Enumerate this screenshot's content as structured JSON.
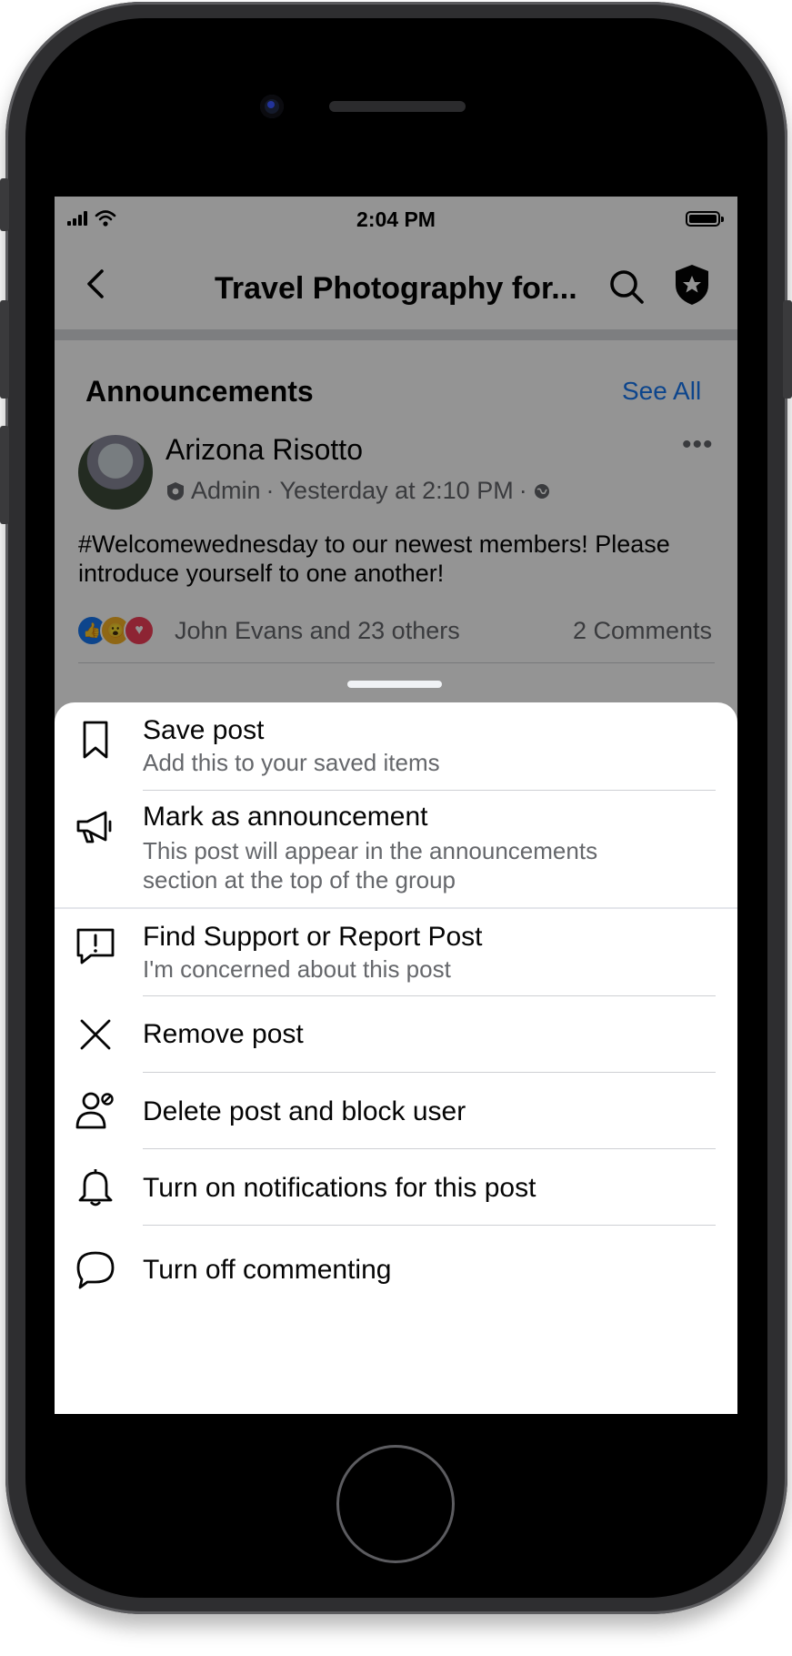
{
  "status_bar": {
    "time": "2:04 PM"
  },
  "nav": {
    "title": "Travel Photography for..."
  },
  "announcements": {
    "heading": "Announcements",
    "see_all": "See All",
    "post": {
      "author": "Arizona Risotto",
      "role": "Admin",
      "separator": "·",
      "time": "Yesterday at 2:10 PM",
      "separator2": "·",
      "text": "#Welcomewednesday to our newest members! Please introduce yourself to one another!",
      "reactions_text": "John Evans and 23 others",
      "comments": "2 Comments"
    }
  },
  "menu": [
    {
      "title": "Save post",
      "subtitle": "Add this to your saved items",
      "icon": "bookmark-icon"
    },
    {
      "title": "Mark as announcement",
      "subtitle": "This post will appear in the announcements section at the top of the group",
      "icon": "megaphone-icon"
    },
    {
      "title": "Find Support or Report Post",
      "subtitle": "I'm concerned about this post",
      "icon": "report-icon"
    },
    {
      "title": "Remove post",
      "subtitle": "",
      "icon": "close-icon"
    },
    {
      "title": "Delete post and block user",
      "subtitle": "",
      "icon": "block-user-icon"
    },
    {
      "title": "Turn on notifications for this post",
      "subtitle": "",
      "icon": "bell-icon"
    },
    {
      "title": "Turn off commenting",
      "subtitle": "",
      "icon": "comment-icon"
    }
  ],
  "colors": {
    "link": "#1877f2",
    "secondary_text": "#65676b",
    "like": "#1877f2",
    "love": "#f33e58",
    "wow": "#f7b125"
  }
}
